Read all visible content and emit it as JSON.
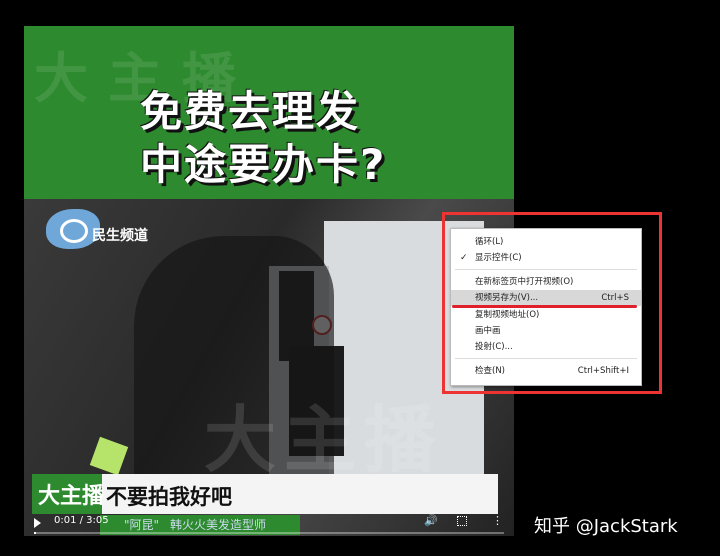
{
  "video": {
    "watermark": "大主播",
    "headline_line1": "免费去理发",
    "headline_line2": "中途要办卡?",
    "channel_name": "民生频道",
    "subtitle": "不要拍我好吧",
    "name_tag": "\"阿昆\"",
    "role_tag": "韩火火美发造型师",
    "lower_watermark": "大主播",
    "time_display": "0:01 / 3:05",
    "progress": 0.005,
    "icons": [
      "play-icon",
      "volume-icon",
      "fullscreen-icon",
      "more-icon"
    ]
  },
  "context_menu": {
    "items": [
      {
        "label": "循环(L)",
        "shortcut": "",
        "checked": false
      },
      {
        "label": "显示控件(C)",
        "shortcut": "",
        "checked": true
      },
      {
        "label": "在新标签页中打开视频(O)",
        "shortcut": "",
        "checked": false
      },
      {
        "label": "视频另存为(V)...",
        "shortcut": "Ctrl+S",
        "checked": false,
        "highlighted": true
      },
      {
        "label": "复制视频地址(O)",
        "shortcut": "",
        "checked": false
      },
      {
        "label": "画中画",
        "shortcut": "",
        "checked": false
      },
      {
        "label": "投射(C)...",
        "shortcut": "",
        "checked": false
      },
      {
        "label": "检查(N)",
        "shortcut": "Ctrl+Shift+I",
        "checked": false
      }
    ]
  },
  "annotation_color": "#e33333",
  "credit": "知乎 @JackStark"
}
